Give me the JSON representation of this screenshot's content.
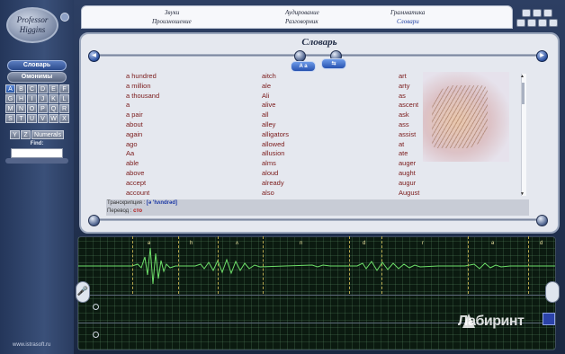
{
  "app": {
    "logo": "Professor Higgins",
    "website": "www.istrasoft.ru"
  },
  "menu": {
    "items": [
      {
        "label": "Звуки"
      },
      {
        "label": "Аудирование"
      },
      {
        "label": "Грамматика"
      },
      {
        "label": "Произношение"
      },
      {
        "label": "Разговорник"
      },
      {
        "label": "Словари"
      }
    ]
  },
  "sidebar": {
    "buttons": [
      "Словарь",
      "Омонимы"
    ],
    "letters": [
      "A",
      "B",
      "C",
      "D",
      "E",
      "F",
      "G",
      "H",
      "I",
      "J",
      "K",
      "L",
      "M",
      "N",
      "O",
      "P",
      "Q",
      "R",
      "S",
      "T",
      "U",
      "V",
      "W",
      "X"
    ],
    "last_row": [
      "Y",
      "Z",
      "Numerals"
    ],
    "find_label": "Find:",
    "find_value": ""
  },
  "dictionary": {
    "title": "Словарь",
    "aa_button": "A a",
    "columns": [
      [
        "a hundred",
        "a million",
        "a thousand",
        "a",
        "a pair",
        "about",
        "again",
        "ago",
        "Aa",
        "able",
        "above",
        "accept",
        "account"
      ],
      [
        "aitch",
        "ale",
        "Ali",
        "alive",
        "all",
        "alley",
        "alligators",
        "allowed",
        "allusion",
        "alms",
        "aloud",
        "already",
        "also"
      ],
      [
        "art",
        "arty",
        "as",
        "ascent",
        "ask",
        "ass",
        "assist",
        "at",
        "ate",
        "auger",
        "aught",
        "augur",
        "August"
      ]
    ],
    "transcription_label": "Транскрипция :",
    "transcription_value": "[ə 'hʌndrəd]",
    "translation_label": "Перевод :",
    "translation_value": "сто"
  },
  "waveform": {
    "phonemes": [
      "ə",
      "h",
      "ʌ",
      "n",
      "d",
      "r",
      "ə",
      "d"
    ]
  },
  "watermark": "Лабиринт",
  "colors": {
    "accent": "#2752b0",
    "word": "#7a1a1a",
    "highlight": "#f6e70c",
    "waveform": "#6ee06a"
  }
}
